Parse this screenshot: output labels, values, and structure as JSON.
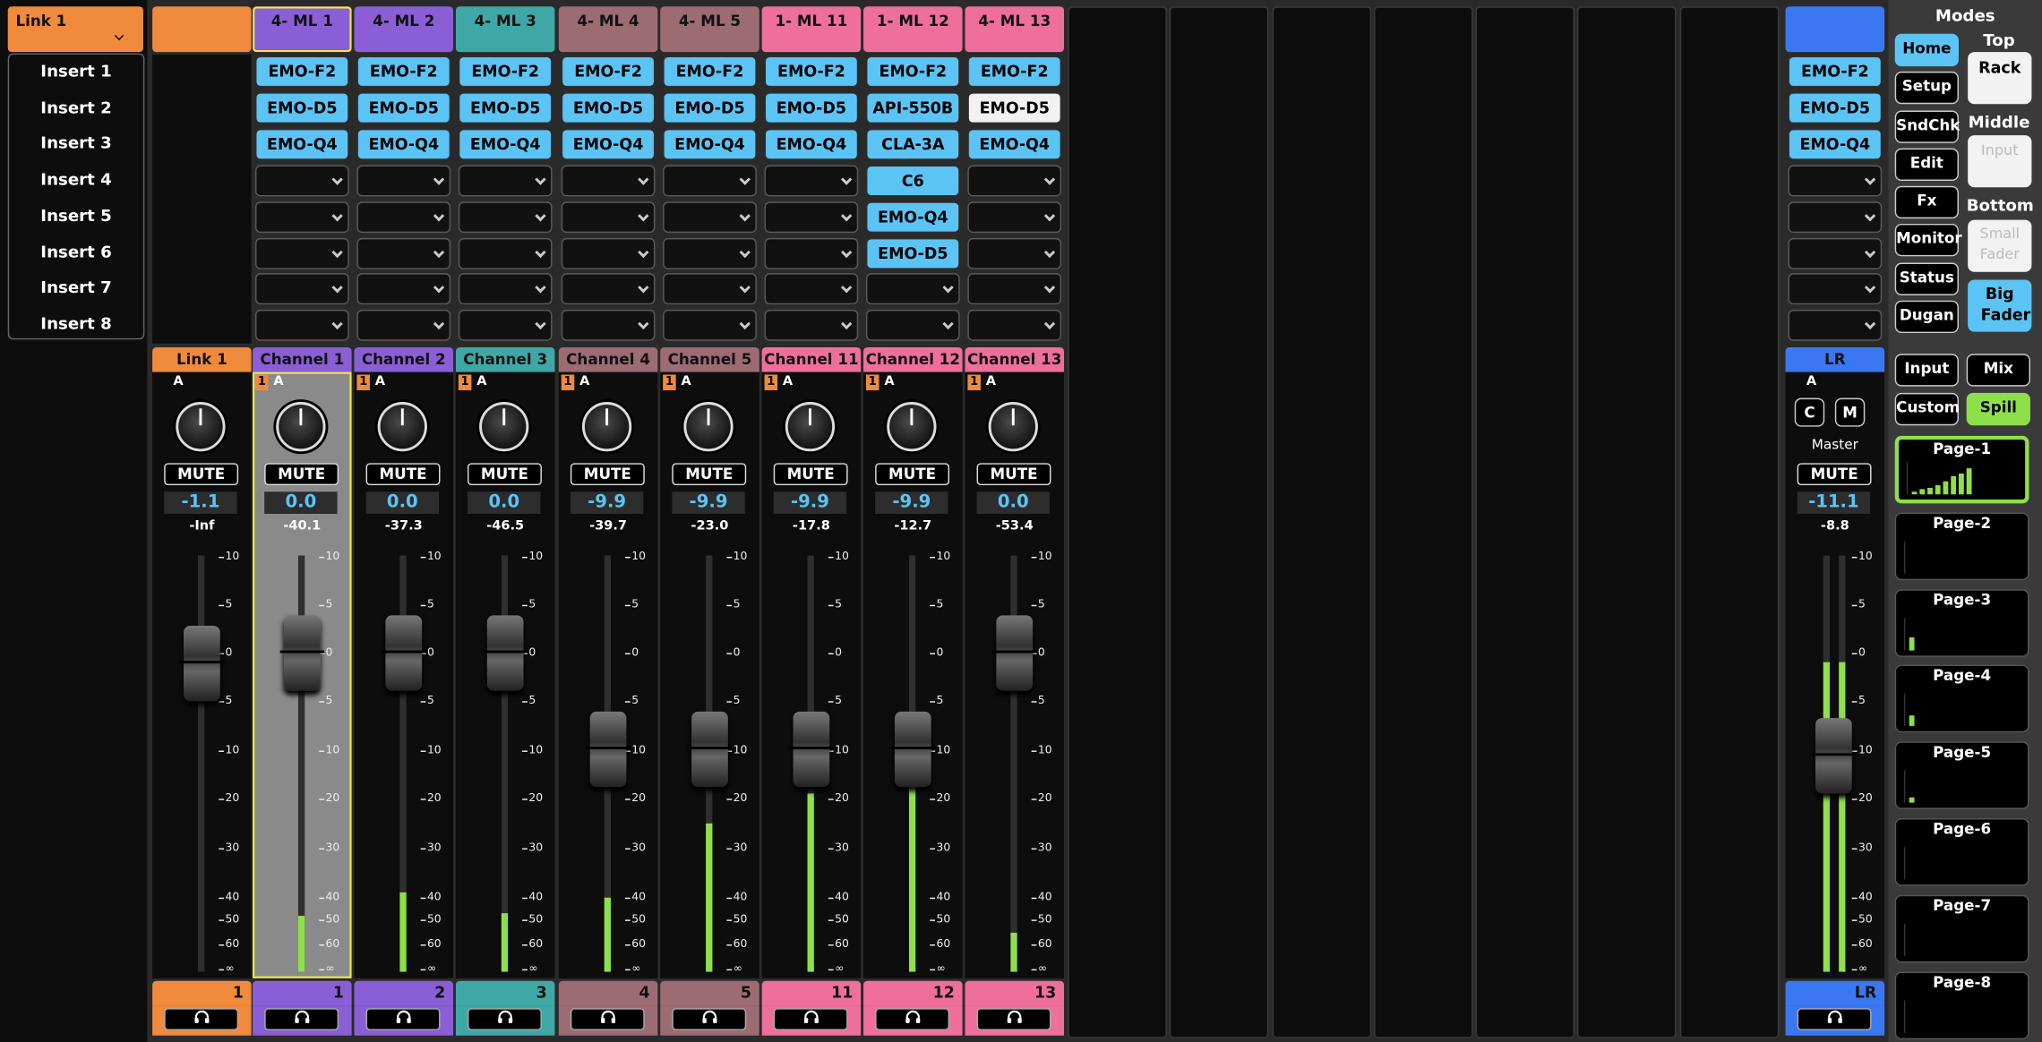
{
  "link_panel": {
    "label": "Link 1",
    "chevron": "chevron-down-icon",
    "inserts": [
      "Insert 1",
      "Insert 2",
      "Insert 3",
      "Insert 4",
      "Insert 5",
      "Insert 6",
      "Insert 7",
      "Insert 8"
    ]
  },
  "channels": [
    {
      "header": "",
      "name": "Link 1",
      "bus": "A",
      "bus_num": "",
      "gain": "-1.1",
      "peak": "-Inf",
      "fader_db": -1.1,
      "meter_db": null,
      "footer": "1",
      "color": "#f08a3c",
      "plugins": [],
      "selected": false
    },
    {
      "header": "4- ML 1",
      "name": "Channel 1",
      "bus": "A",
      "bus_num": "1",
      "gain": "0.0",
      "peak": "-40.1",
      "fader_db": 0,
      "meter_db": -48,
      "footer": "1",
      "color": "#8a5fd6",
      "plugins": [
        "EMO-F2",
        "EMO-D5",
        "EMO-Q4"
      ],
      "selected": true
    },
    {
      "header": "4- ML 2",
      "name": "Channel 2",
      "bus": "A",
      "bus_num": "1",
      "gain": "0.0",
      "peak": "-37.3",
      "fader_db": 0,
      "meter_db": -39,
      "footer": "2",
      "color": "#8a5fd6",
      "plugins": [
        "EMO-F2",
        "EMO-D5",
        "EMO-Q4"
      ],
      "selected": false
    },
    {
      "header": "4- ML 3",
      "name": "Channel 3",
      "bus": "A",
      "bus_num": "1",
      "gain": "0.0",
      "peak": "-46.5",
      "fader_db": 0,
      "meter_db": -47,
      "footer": "3",
      "color": "#3fa8a6",
      "plugins": [
        "EMO-F2",
        "EMO-D5",
        "EMO-Q4"
      ],
      "selected": false
    },
    {
      "header": "4- ML 4",
      "name": "Channel 4",
      "bus": "A",
      "bus_num": "1",
      "gain": "-9.9",
      "peak": "-39.7",
      "fader_db": -9.9,
      "meter_db": -40,
      "footer": "4",
      "color": "#9c6b74",
      "plugins": [
        "EMO-F2",
        "EMO-D5",
        "EMO-Q4"
      ],
      "selected": false
    },
    {
      "header": "4- ML 5",
      "name": "Channel 5",
      "bus": "A",
      "bus_num": "1",
      "gain": "-9.9",
      "peak": "-23.0",
      "fader_db": -9.9,
      "meter_db": -25,
      "footer": "5",
      "color": "#9c6b74",
      "plugins": [
        "EMO-F2",
        "EMO-D5",
        "EMO-Q4"
      ],
      "selected": false
    },
    {
      "header": "1- ML 11",
      "name": "Channel 11",
      "bus": "A",
      "bus_num": "1",
      "gain": "-9.9",
      "peak": "-17.8",
      "fader_db": -9.9,
      "meter_db": -19,
      "footer": "11",
      "color": "#ef6f9c",
      "plugins": [
        "EMO-F2",
        "EMO-D5",
        "EMO-Q4"
      ],
      "selected": false
    },
    {
      "header": "1- ML 12",
      "name": "Channel 12",
      "bus": "A",
      "bus_num": "1",
      "gain": "-9.9",
      "peak": "-12.7",
      "fader_db": -9.9,
      "meter_db": -14,
      "footer": "12",
      "color": "#ef6f9c",
      "plugins": [
        "EMO-F2",
        "API-550B",
        "CLA-3A",
        "C6",
        "EMO-Q4",
        "EMO-D5"
      ],
      "selected": false
    },
    {
      "header": "4- ML 13",
      "name": "Channel 13",
      "bus": "A",
      "bus_num": "1",
      "gain": "0.0",
      "peak": "-53.4",
      "fader_db": 0,
      "meter_db": -55,
      "footer": "13",
      "color": "#ef6f9c",
      "plugins": [
        "EMO-F2",
        "EMO-D5",
        "EMO-Q4"
      ],
      "selected": false
    }
  ],
  "master": {
    "name": "LR",
    "bus": "A",
    "c_label": "C",
    "m_label": "M",
    "sub_label": "Master",
    "mute": "MUTE",
    "gain": "-11.1",
    "peak": "-8.8",
    "fader_db": -11.1,
    "meter_db": -1,
    "footer": "LR",
    "color": "#3a78f2",
    "plugins": [
      "EMO-F2",
      "EMO-D5",
      "EMO-Q4"
    ]
  },
  "mute_label": "MUTE",
  "headphone_icon": "headphone-icon",
  "scale_labels": [
    "10",
    "5",
    "0",
    "5",
    "10",
    "20",
    "30",
    "40",
    "50",
    "60",
    "∞"
  ],
  "modes": {
    "title": "Modes",
    "buttons": [
      "Home",
      "Setup",
      "SndChk",
      "Edit",
      "Fx",
      "Monitor",
      "Status",
      "Dugan"
    ],
    "active": "Home",
    "top_label": "Top",
    "top_btn": "Rack",
    "middle_label": "Middle",
    "middle_btn": "Input",
    "bottom_label": "Bottom",
    "bottom_small": "Small Fader",
    "bottom_big": "Big Fader",
    "view_buttons": [
      "Input",
      "Mix",
      "Custom",
      "Spill"
    ],
    "pages": [
      {
        "label": "Page-1",
        "bars": [
          0.1,
          0.15,
          0.2,
          0.3,
          0.4,
          0.55,
          0.65,
          0.8
        ]
      },
      {
        "label": "Page-2",
        "bars": []
      },
      {
        "label": "Page-3",
        "bars": [
          0.4
        ]
      },
      {
        "label": "Page-4",
        "bars": [
          0.35
        ]
      },
      {
        "label": "Page-5",
        "bars": [
          0.15
        ]
      },
      {
        "label": "Page-6",
        "bars": []
      },
      {
        "label": "Page-7",
        "bars": []
      },
      {
        "label": "Page-8",
        "bars": []
      }
    ]
  }
}
